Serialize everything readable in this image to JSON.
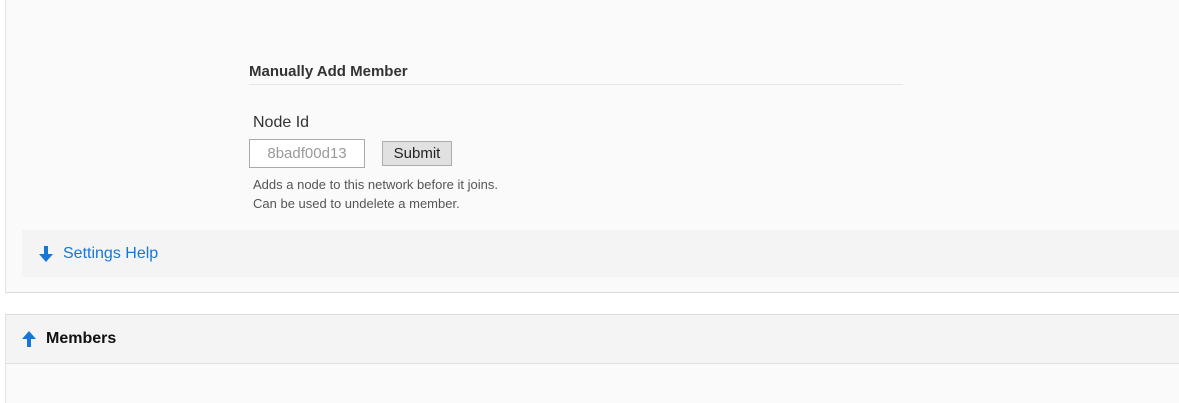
{
  "manual_add": {
    "title": "Manually Add Member",
    "node_id_label": "Node Id",
    "node_id_placeholder": "8badf00d13",
    "submit_label": "Submit",
    "help_line_1": "Adds a node to this network before it joins.",
    "help_line_2": "Can be used to undelete a member."
  },
  "settings_help": {
    "label": "Settings Help",
    "icon": "arrow-down-icon"
  },
  "members": {
    "label": "Members",
    "icon": "arrow-up-icon"
  },
  "colors": {
    "link": "#1677d9",
    "panel_bg": "#fafafa",
    "bar_bg": "#f4f4f4"
  }
}
